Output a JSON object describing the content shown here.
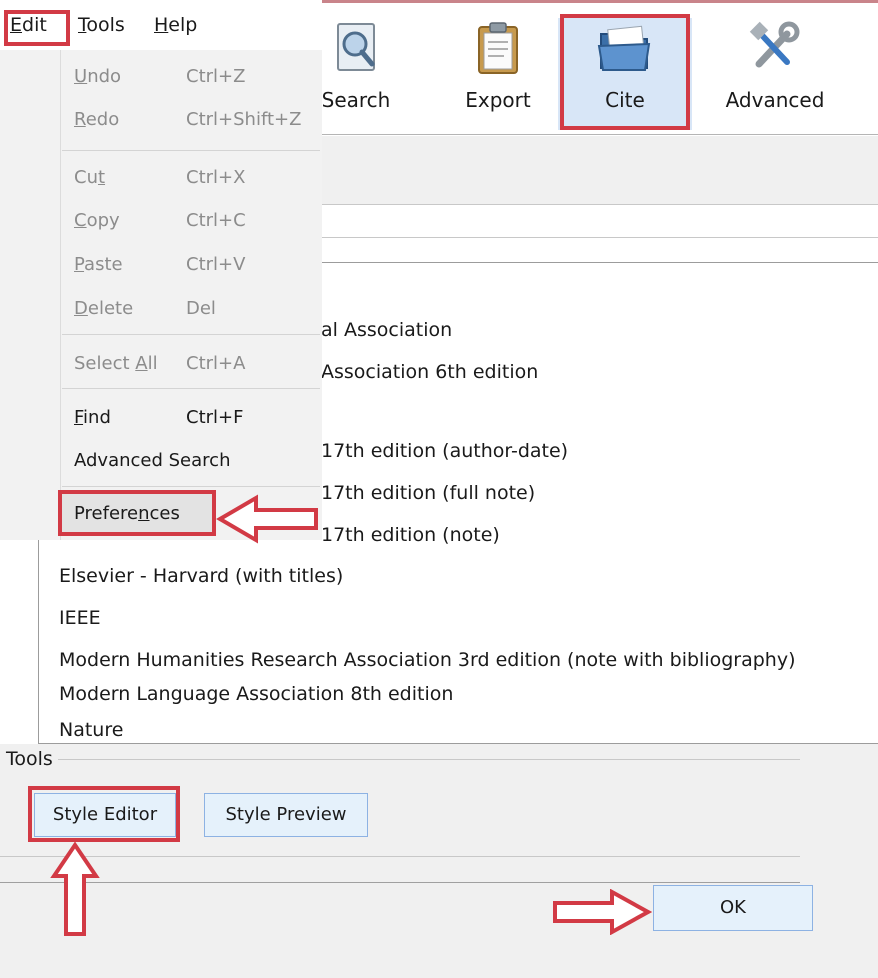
{
  "menubar": {
    "items": [
      {
        "label": "Edit",
        "accel_index": 0
      },
      {
        "label": "Tools",
        "accel_index": 0
      },
      {
        "label": "Help",
        "accel_index": 0
      }
    ]
  },
  "toolbar": {
    "buttons": [
      {
        "label": "Search",
        "icon": "magnifier-document-icon"
      },
      {
        "label": "Export",
        "icon": "clipboard-icon"
      },
      {
        "label": "Cite",
        "icon": "folder-icon",
        "selected": true
      },
      {
        "label": "Advanced",
        "icon": "tools-icon"
      }
    ]
  },
  "edit_menu": {
    "items": [
      {
        "pre": "",
        "accel": "U",
        "post": "ndo",
        "shortcut": "Ctrl+Z",
        "disabled": true
      },
      {
        "pre": "",
        "accel": "R",
        "post": "edo",
        "shortcut": "Ctrl+Shift+Z",
        "disabled": true
      },
      {
        "pre": "Cu",
        "accel": "t",
        "post": "",
        "shortcut": "Ctrl+X",
        "disabled": true
      },
      {
        "pre": "",
        "accel": "C",
        "post": "opy",
        "shortcut": "Ctrl+C",
        "disabled": true
      },
      {
        "pre": "",
        "accel": "P",
        "post": "aste",
        "shortcut": "Ctrl+V",
        "disabled": true
      },
      {
        "pre": "",
        "accel": "D",
        "post": "elete",
        "shortcut": "Del",
        "disabled": true
      },
      {
        "pre": "Select ",
        "accel": "A",
        "post": "ll",
        "shortcut": "Ctrl+A",
        "disabled": true
      },
      {
        "pre": "",
        "accel": "F",
        "post": "ind",
        "shortcut": "Ctrl+F",
        "disabled": false
      },
      {
        "pre": "Advanced Search",
        "accel": "",
        "post": "",
        "shortcut": "",
        "disabled": false
      },
      {
        "pre": "Prefere",
        "accel": "n",
        "post": "ces",
        "shortcut": "",
        "disabled": false
      }
    ]
  },
  "style_list": {
    "items": [
      "al Association",
      "Association 6th edition",
      "17th edition (author-date)",
      "17th edition (full note)",
      "17th edition (note)",
      "Elsevier - Harvard (with titles)",
      "IEEE",
      "Modern Humanities Research Association 3rd edition (note with bibliography)",
      "Modern Language Association 8th edition",
      "Nature"
    ]
  },
  "tools_section": {
    "title": "Tools",
    "style_editor_label": "Style Editor",
    "style_preview_label": "Style Preview"
  },
  "dialog": {
    "ok_label": "OK"
  },
  "colors": {
    "highlight": "#d23a45",
    "selected_tab": "#d8e6f7",
    "button_fill": "#e5f1fb",
    "button_border": "#8db2e3"
  }
}
